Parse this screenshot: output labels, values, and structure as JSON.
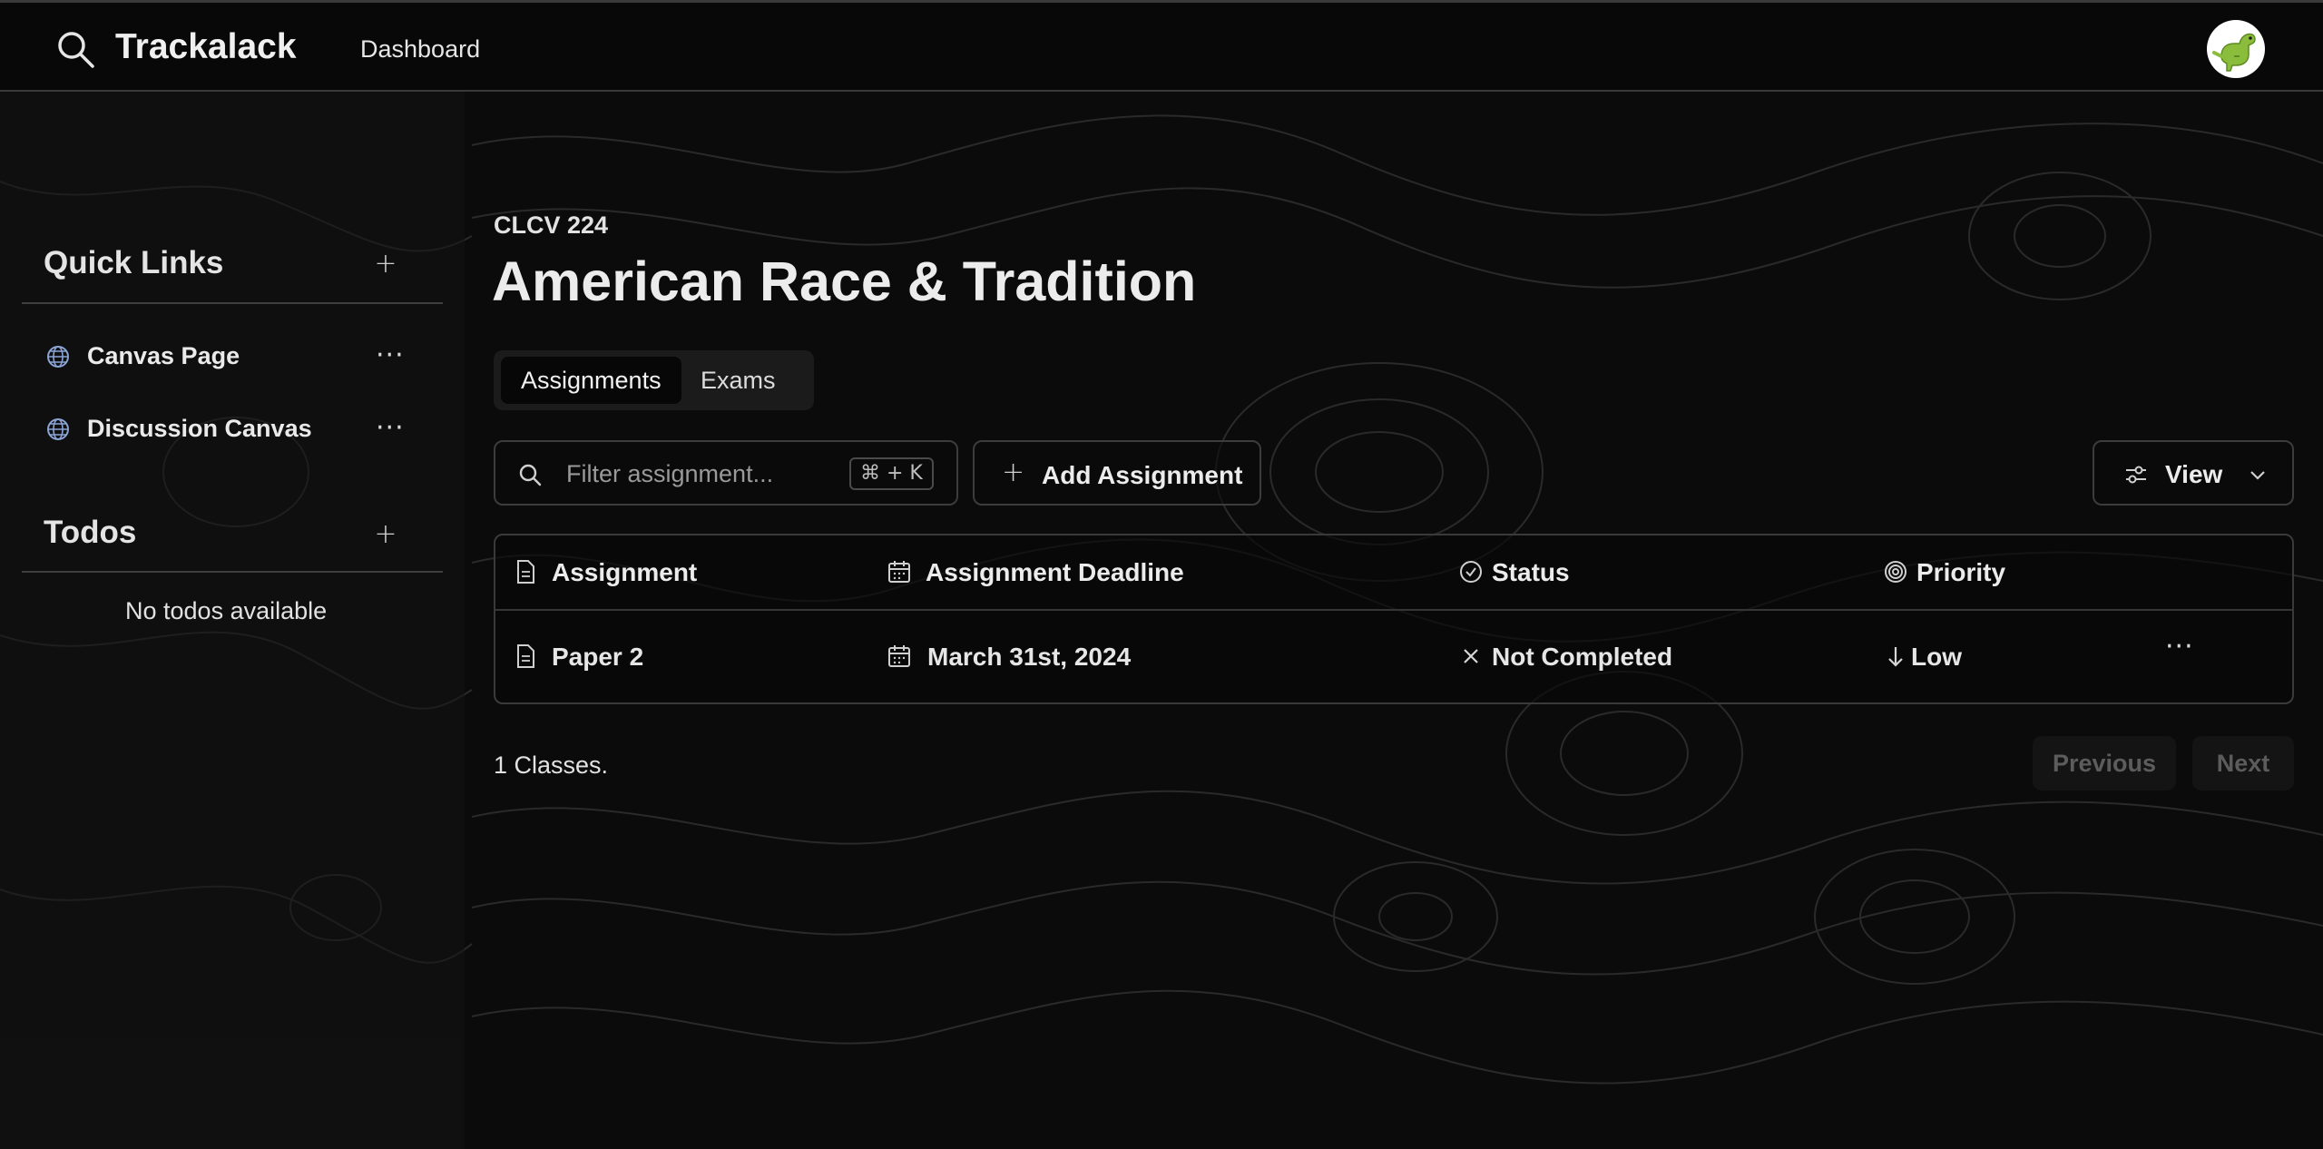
{
  "topbar": {
    "search_icon": "search-icon",
    "brand": "Trackalack",
    "nav_dashboard": "Dashboard",
    "avatar_icon": "dinosaur-avatar"
  },
  "sidebar": {
    "quick_links": {
      "title": "Quick Links",
      "items": [
        {
          "label": "Canvas Page",
          "icon": "globe-icon"
        },
        {
          "label": "Discussion Canvas",
          "icon": "globe-icon"
        }
      ]
    },
    "todos": {
      "title": "Todos",
      "empty_text": "No todos available"
    }
  },
  "course": {
    "code": "CLCV 224",
    "title": "American Race & Tradition"
  },
  "tabs": [
    {
      "label": "Assignments",
      "active": true
    },
    {
      "label": "Exams",
      "active": false
    }
  ],
  "toolbar": {
    "filter_placeholder": "Filter assignment...",
    "shortcut": "⌘ + K",
    "add_label": "Add Assignment",
    "view_label": "View"
  },
  "table": {
    "columns": [
      "Assignment",
      "Assignment Deadline",
      "Status",
      "Priority"
    ],
    "rows": [
      {
        "assignment": "Paper 2",
        "deadline": "March 31st, 2024",
        "status": "Not Completed",
        "priority": "Low"
      }
    ]
  },
  "footer": {
    "count_text": "1 Classes.",
    "previous": "Previous",
    "next": "Next"
  },
  "colors": {
    "background": "#0b0b0b",
    "text": "#e8e8e8",
    "border": "#3a3a3a",
    "disabled_text": "#5c5c5c"
  }
}
